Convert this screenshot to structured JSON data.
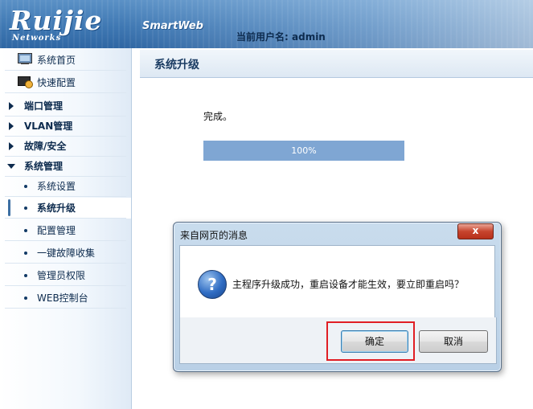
{
  "header": {
    "logo_text": "Ruijie",
    "logo_subtext": "Networks",
    "product": "SmartWeb",
    "user_label": "当前用户名:",
    "user_name": "admin"
  },
  "sidebar": {
    "home": "系统首页",
    "quick": "快速配置",
    "groups": [
      "端口管理",
      "VLAN管理",
      "故障/安全",
      "系统管理"
    ],
    "sub_items": [
      "系统设置",
      "系统升级",
      "配置管理",
      "一键故障收集",
      "管理员权限",
      "WEB控制台"
    ]
  },
  "content": {
    "title": "系统升级",
    "status_text": "完成。",
    "progress": {
      "value": 100,
      "label": "100%"
    }
  },
  "dialog": {
    "title": "来自网页的消息",
    "message": "主程序升级成功，重启设备才能生效，要立即重启吗？",
    "ok_label": "确定",
    "cancel_label": "取消",
    "close_glyph": "x"
  },
  "colors": {
    "header": "#3f78b3",
    "progress": "#7fa6d3",
    "highlight": "#e01e24"
  }
}
